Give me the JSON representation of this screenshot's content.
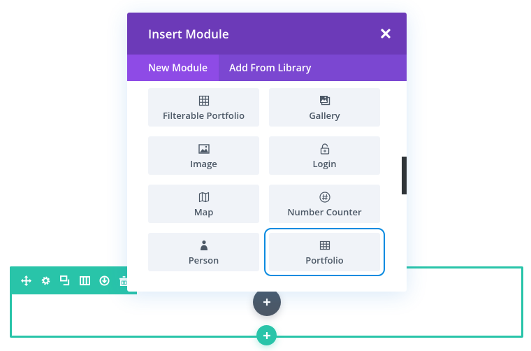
{
  "modal": {
    "title": "Insert Module",
    "close_icon": "close-icon",
    "tabs": [
      {
        "label": "New Module",
        "active": true
      },
      {
        "label": "Add From Library",
        "active": false
      }
    ],
    "modules": [
      {
        "label": "Filterable Portfolio",
        "icon": "grid-icon"
      },
      {
        "label": "Gallery",
        "icon": "gallery-icon"
      },
      {
        "label": "Image",
        "icon": "image-icon"
      },
      {
        "label": "Login",
        "icon": "lock-open-icon"
      },
      {
        "label": "Map",
        "icon": "map-icon"
      },
      {
        "label": "Number Counter",
        "icon": "hash-icon"
      },
      {
        "label": "Person",
        "icon": "person-icon"
      },
      {
        "label": "Portfolio",
        "icon": "grid-icon",
        "selected": true
      }
    ]
  },
  "row_toolbar": {
    "icons": [
      "move-icon",
      "gear-icon",
      "duplicate-icon",
      "columns-icon",
      "save-icon",
      "trash-icon"
    ]
  },
  "colors": {
    "modal_header": "#6c3ab8",
    "tabs_bar": "#7b47d1",
    "active_tab": "#8e4be6",
    "row_accent": "#29c4a9",
    "selected_outline": "#0c8be0",
    "card_bg": "#f0f3f8",
    "text": "#4c5866"
  }
}
